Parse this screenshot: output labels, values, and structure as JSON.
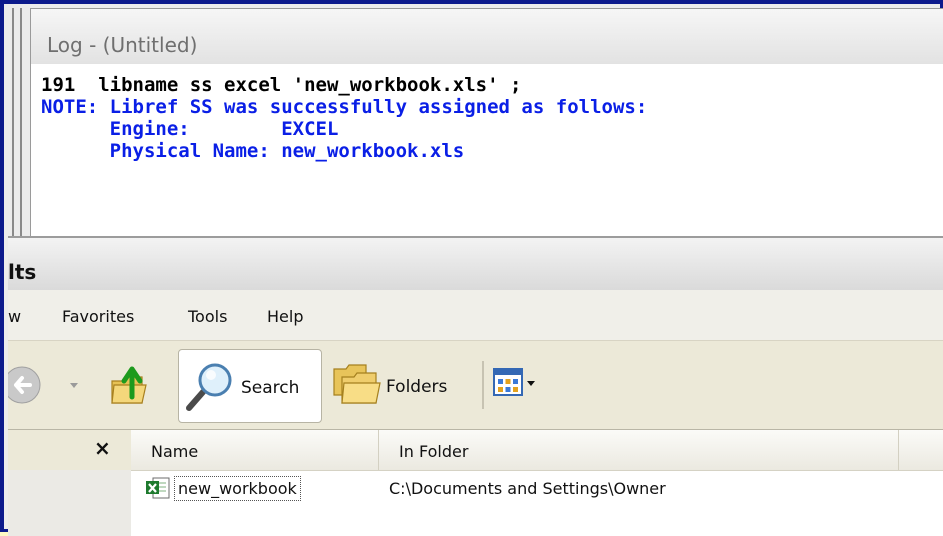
{
  "log_window": {
    "title": "Log - (Untitled)",
    "lines": [
      {
        "text": "191  libname ss excel 'new_workbook.xls' ;",
        "color": "#000000"
      },
      {
        "text": "NOTE: Libref SS was successfully assigned as follows:",
        "color": "#0a1fe6"
      },
      {
        "text": "      Engine:        EXCEL",
        "color": "#0a1fe6"
      },
      {
        "text": "      Physical Name: new_workbook.xls",
        "color": "#0a1fe6"
      }
    ]
  },
  "explorer": {
    "title": "lts",
    "menu": {
      "view": "w",
      "favorites": "Favorites",
      "tools": "Tools",
      "help": "Help"
    },
    "toolbar": {
      "search_label": "Search",
      "folders_label": "Folders",
      "icons": [
        "back-arrow-icon",
        "dropdown-arrow-icon",
        "up-folder-icon",
        "search-icon",
        "folders-icon",
        "views-icon"
      ]
    },
    "left_pane": {
      "close_glyph": "×"
    },
    "list": {
      "columns": [
        "Name",
        "In Folder"
      ],
      "rows": [
        {
          "name": "new_workbook",
          "folder": "C:\\Documents and Settings\\Owner",
          "icon": "excel-file-icon"
        }
      ]
    }
  },
  "colors": {
    "frame_border": "#0c1a8c",
    "log_blue": "#0a1fe6",
    "outer_background": "#fff9c4"
  }
}
